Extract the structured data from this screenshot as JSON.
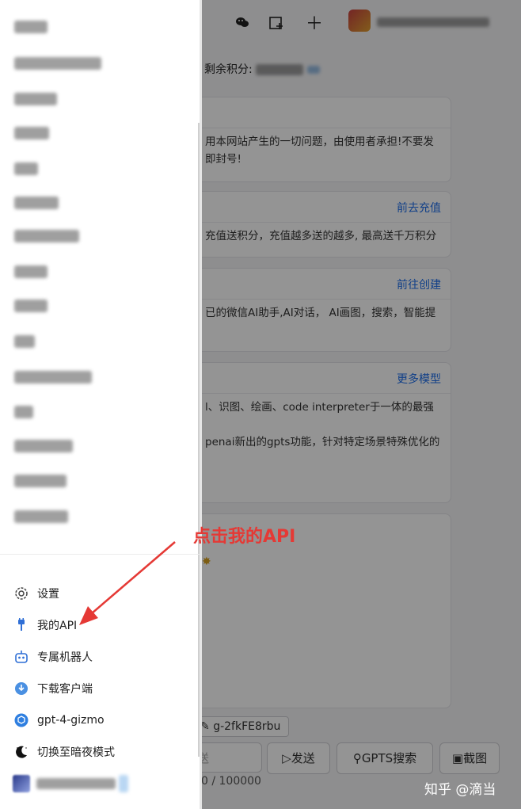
{
  "header": {
    "wechat_icon": "wechat-icon",
    "image_icon": "image-add-icon",
    "plus_icon": "plus-icon"
  },
  "credits": {
    "label": "剩余积分:"
  },
  "cards": [
    {
      "link": "",
      "text": "用本网站产生的一切问题，由使用者承担!不要发\n即封号!"
    },
    {
      "link": "前去充值",
      "text": "充值送积分，充值越多送的越多, 最高送千万积分"
    },
    {
      "link": "前往创建",
      "text": "已的微信AI助手,AI对话， AI画图，搜索，智能提"
    },
    {
      "link": "更多模型",
      "text": "l、识图、绘画、code interpreter于一体的最强\n\npenai新出的gpts功能，针对特定场景特殊优化的"
    }
  ],
  "tag_button": {
    "label": "g-2fkFE8rbu"
  },
  "input": {
    "placeholder": "送"
  },
  "actions": {
    "send": "发送",
    "gpts_search": "GPTS搜索",
    "screenshot": "截图"
  },
  "counter": "0 / 100000",
  "annotation": "点击我的API",
  "watermark": "知乎 @滴当",
  "sidebar": {
    "menu": [
      {
        "label": "设置",
        "icon": "gear-icon"
      },
      {
        "label": "我的API",
        "icon": "api-plug-icon"
      },
      {
        "label": "专属机器人",
        "icon": "robot-icon"
      },
      {
        "label": "下载客户端",
        "icon": "download-icon"
      },
      {
        "label": "gpt-4-gizmo",
        "icon": "cube-icon"
      },
      {
        "label": "切换至暗夜模式",
        "icon": "moon-icon"
      }
    ]
  },
  "colors": {
    "link": "#1f6feb",
    "annotation": "#e53935"
  }
}
